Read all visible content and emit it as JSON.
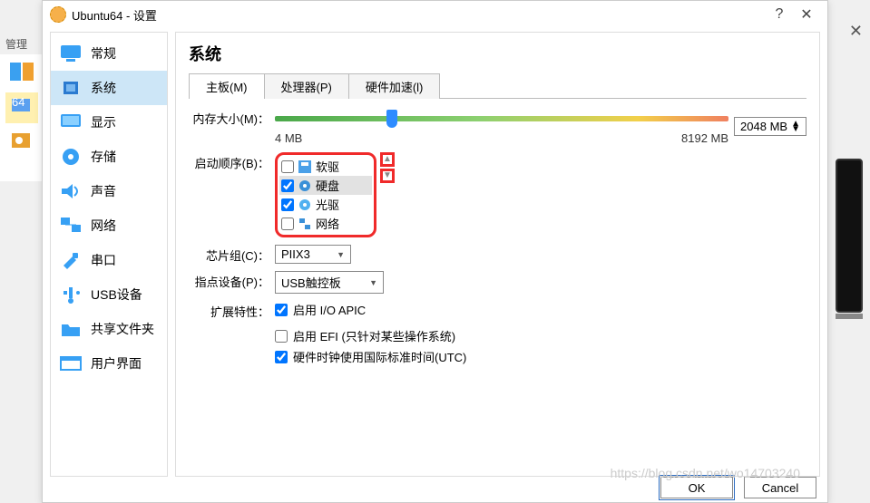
{
  "bg": {
    "text": "管理"
  },
  "window": {
    "title": "Ubuntu64 - 设置",
    "help": "?",
    "close": "✕"
  },
  "sidebar": {
    "items": [
      {
        "label": "常规"
      },
      {
        "label": "系统"
      },
      {
        "label": "显示"
      },
      {
        "label": "存储"
      },
      {
        "label": "声音"
      },
      {
        "label": "网络"
      },
      {
        "label": "串口"
      },
      {
        "label": "USB设备"
      },
      {
        "label": "共享文件夹"
      },
      {
        "label": "用户界面"
      }
    ]
  },
  "main": {
    "heading": "系统",
    "tabs": [
      {
        "label": "主板(M)"
      },
      {
        "label": "处理器(P)"
      },
      {
        "label": "硬件加速(l)"
      }
    ],
    "memory": {
      "label": "内存大小(M)：",
      "min_label": "4 MB",
      "max_label": "8192 MB",
      "value": "2048 MB"
    },
    "boot": {
      "label": "启动顺序(B)：",
      "items": [
        {
          "label": "软驱",
          "checked": false
        },
        {
          "label": "硬盘",
          "checked": true,
          "selected": true
        },
        {
          "label": "光驱",
          "checked": true
        },
        {
          "label": "网络",
          "checked": false
        }
      ]
    },
    "chipset": {
      "label": "芯片组(C)：",
      "value": "PIIX3"
    },
    "pointing": {
      "label": "指点设备(P)：",
      "value": "USB触控板"
    },
    "ext": {
      "label": "扩展特性：",
      "items": [
        {
          "label": "启用 I/O APIC",
          "checked": true
        },
        {
          "label": "启用 EFI (只针对某些操作系统)",
          "checked": false
        },
        {
          "label": "硬件时钟使用国际标准时间(UTC)",
          "checked": true
        }
      ]
    }
  },
  "buttons": {
    "ok": "OK",
    "cancel": "Cancel"
  },
  "watermark": "https://blog.csdn.net/wo14703240"
}
